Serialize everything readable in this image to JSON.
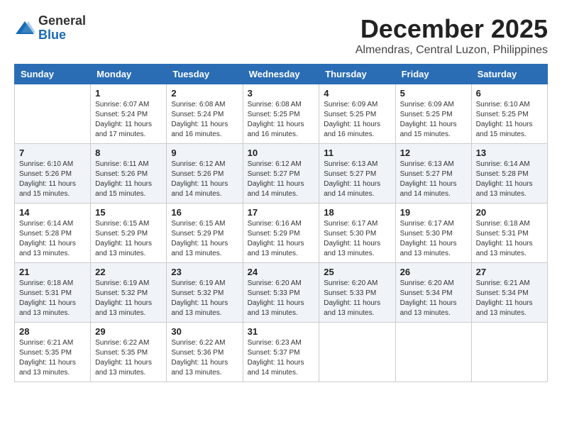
{
  "header": {
    "logo_general": "General",
    "logo_blue": "Blue",
    "month_title": "December 2025",
    "location": "Almendras, Central Luzon, Philippines"
  },
  "weekdays": [
    "Sunday",
    "Monday",
    "Tuesday",
    "Wednesday",
    "Thursday",
    "Friday",
    "Saturday"
  ],
  "weeks": [
    [
      {
        "day": "",
        "sunrise": "",
        "sunset": "",
        "daylight": ""
      },
      {
        "day": "1",
        "sunrise": "6:07 AM",
        "sunset": "5:24 PM",
        "daylight": "11 hours and 17 minutes."
      },
      {
        "day": "2",
        "sunrise": "6:08 AM",
        "sunset": "5:24 PM",
        "daylight": "11 hours and 16 minutes."
      },
      {
        "day": "3",
        "sunrise": "6:08 AM",
        "sunset": "5:25 PM",
        "daylight": "11 hours and 16 minutes."
      },
      {
        "day": "4",
        "sunrise": "6:09 AM",
        "sunset": "5:25 PM",
        "daylight": "11 hours and 16 minutes."
      },
      {
        "day": "5",
        "sunrise": "6:09 AM",
        "sunset": "5:25 PM",
        "daylight": "11 hours and 15 minutes."
      },
      {
        "day": "6",
        "sunrise": "6:10 AM",
        "sunset": "5:25 PM",
        "daylight": "11 hours and 15 minutes."
      }
    ],
    [
      {
        "day": "7",
        "sunrise": "6:10 AM",
        "sunset": "5:26 PM",
        "daylight": "11 hours and 15 minutes."
      },
      {
        "day": "8",
        "sunrise": "6:11 AM",
        "sunset": "5:26 PM",
        "daylight": "11 hours and 15 minutes."
      },
      {
        "day": "9",
        "sunrise": "6:12 AM",
        "sunset": "5:26 PM",
        "daylight": "11 hours and 14 minutes."
      },
      {
        "day": "10",
        "sunrise": "6:12 AM",
        "sunset": "5:27 PM",
        "daylight": "11 hours and 14 minutes."
      },
      {
        "day": "11",
        "sunrise": "6:13 AM",
        "sunset": "5:27 PM",
        "daylight": "11 hours and 14 minutes."
      },
      {
        "day": "12",
        "sunrise": "6:13 AM",
        "sunset": "5:27 PM",
        "daylight": "11 hours and 14 minutes."
      },
      {
        "day": "13",
        "sunrise": "6:14 AM",
        "sunset": "5:28 PM",
        "daylight": "11 hours and 13 minutes."
      }
    ],
    [
      {
        "day": "14",
        "sunrise": "6:14 AM",
        "sunset": "5:28 PM",
        "daylight": "11 hours and 13 minutes."
      },
      {
        "day": "15",
        "sunrise": "6:15 AM",
        "sunset": "5:29 PM",
        "daylight": "11 hours and 13 minutes."
      },
      {
        "day": "16",
        "sunrise": "6:15 AM",
        "sunset": "5:29 PM",
        "daylight": "11 hours and 13 minutes."
      },
      {
        "day": "17",
        "sunrise": "6:16 AM",
        "sunset": "5:29 PM",
        "daylight": "11 hours and 13 minutes."
      },
      {
        "day": "18",
        "sunrise": "6:17 AM",
        "sunset": "5:30 PM",
        "daylight": "11 hours and 13 minutes."
      },
      {
        "day": "19",
        "sunrise": "6:17 AM",
        "sunset": "5:30 PM",
        "daylight": "11 hours and 13 minutes."
      },
      {
        "day": "20",
        "sunrise": "6:18 AM",
        "sunset": "5:31 PM",
        "daylight": "11 hours and 13 minutes."
      }
    ],
    [
      {
        "day": "21",
        "sunrise": "6:18 AM",
        "sunset": "5:31 PM",
        "daylight": "11 hours and 13 minutes."
      },
      {
        "day": "22",
        "sunrise": "6:19 AM",
        "sunset": "5:32 PM",
        "daylight": "11 hours and 13 minutes."
      },
      {
        "day": "23",
        "sunrise": "6:19 AM",
        "sunset": "5:32 PM",
        "daylight": "11 hours and 13 minutes."
      },
      {
        "day": "24",
        "sunrise": "6:20 AM",
        "sunset": "5:33 PM",
        "daylight": "11 hours and 13 minutes."
      },
      {
        "day": "25",
        "sunrise": "6:20 AM",
        "sunset": "5:33 PM",
        "daylight": "11 hours and 13 minutes."
      },
      {
        "day": "26",
        "sunrise": "6:20 AM",
        "sunset": "5:34 PM",
        "daylight": "11 hours and 13 minutes."
      },
      {
        "day": "27",
        "sunrise": "6:21 AM",
        "sunset": "5:34 PM",
        "daylight": "11 hours and 13 minutes."
      }
    ],
    [
      {
        "day": "28",
        "sunrise": "6:21 AM",
        "sunset": "5:35 PM",
        "daylight": "11 hours and 13 minutes."
      },
      {
        "day": "29",
        "sunrise": "6:22 AM",
        "sunset": "5:35 PM",
        "daylight": "11 hours and 13 minutes."
      },
      {
        "day": "30",
        "sunrise": "6:22 AM",
        "sunset": "5:36 PM",
        "daylight": "11 hours and 13 minutes."
      },
      {
        "day": "31",
        "sunrise": "6:23 AM",
        "sunset": "5:37 PM",
        "daylight": "11 hours and 14 minutes."
      },
      {
        "day": "",
        "sunrise": "",
        "sunset": "",
        "daylight": ""
      },
      {
        "day": "",
        "sunrise": "",
        "sunset": "",
        "daylight": ""
      },
      {
        "day": "",
        "sunrise": "",
        "sunset": "",
        "daylight": ""
      }
    ]
  ]
}
